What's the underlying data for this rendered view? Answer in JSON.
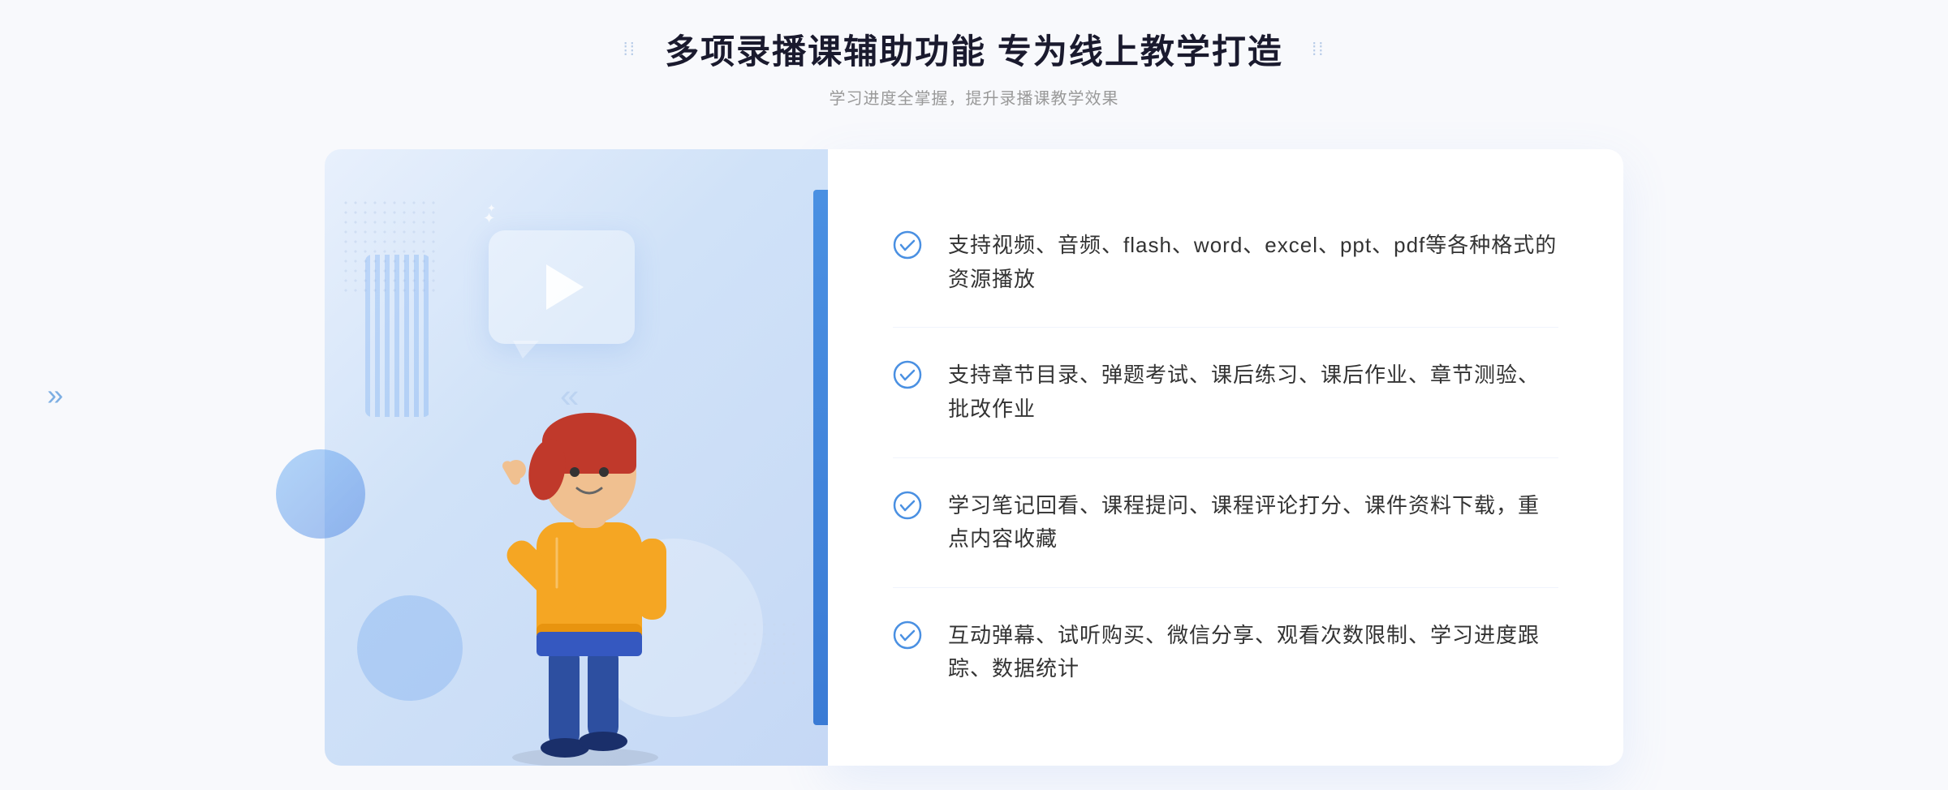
{
  "header": {
    "title": "多项录播课辅助功能 专为线上教学打造",
    "subtitle": "学习进度全掌握，提升录播课教学效果",
    "dots_left": "⁞⁞",
    "dots_right": "⁞⁞"
  },
  "features": [
    {
      "id": 1,
      "text": "支持视频、音频、flash、word、excel、ppt、pdf等各种格式的资源播放"
    },
    {
      "id": 2,
      "text": "支持章节目录、弹题考试、课后练习、课后作业、章节测验、批改作业"
    },
    {
      "id": 3,
      "text": "学习笔记回看、课程提问、课程评论打分、课件资料下载，重点内容收藏"
    },
    {
      "id": 4,
      "text": "互动弹幕、试听购买、微信分享、观看次数限制、学习进度跟踪、数据统计"
    }
  ],
  "colors": {
    "primary_blue": "#4a90e2",
    "light_blue": "#e8f0fc",
    "text_dark": "#1a1a2e",
    "text_gray": "#999999",
    "text_main": "#333333",
    "check_color": "#4a90e2"
  },
  "chevron": "»",
  "play_icon": "▶"
}
